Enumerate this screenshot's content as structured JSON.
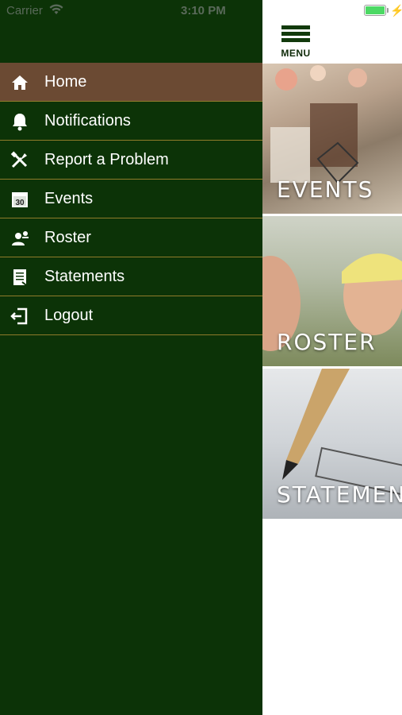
{
  "status_bar": {
    "carrier": "Carrier",
    "time": "3:10 PM",
    "battery_color": "#4cd964"
  },
  "header": {
    "menu_label": "MENU"
  },
  "drawer": {
    "background": "#0c3307",
    "active_background": "#6b4a33",
    "items": [
      {
        "label": "Home",
        "icon": "home-icon"
      },
      {
        "label": "Notifications",
        "icon": "bell-icon"
      },
      {
        "label": "Report a Problem",
        "icon": "tools-icon"
      },
      {
        "label": "Events",
        "icon": "calendar-icon"
      },
      {
        "label": "Roster",
        "icon": "person-icon"
      },
      {
        "label": "Statements",
        "icon": "document-icon"
      },
      {
        "label": "Logout",
        "icon": "logout-icon"
      }
    ]
  },
  "tiles": [
    {
      "label": "EVENTS"
    },
    {
      "label": "ROSTER"
    },
    {
      "label": "STATEMEN"
    }
  ]
}
